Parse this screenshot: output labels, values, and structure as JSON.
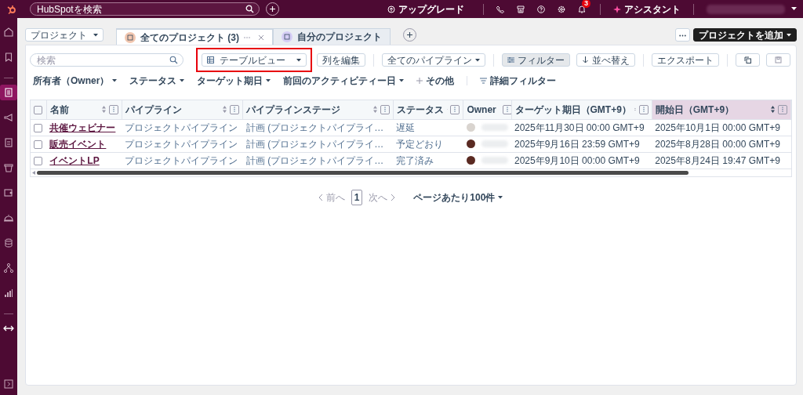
{
  "top_bar": {
    "search": {
      "placeholder": "HubSpotを検索"
    },
    "upgrade": "アップグレード",
    "notifications": {
      "count": "3"
    },
    "assistant": "アシスタント"
  },
  "sidebar": {
    "items": [
      {
        "selected": false
      },
      {
        "selected": false
      },
      {
        "selected": true
      },
      {
        "selected": false
      },
      {
        "selected": false
      },
      {
        "selected": false
      },
      {
        "selected": false
      },
      {
        "selected": false
      },
      {
        "selected": false
      },
      {
        "selected": false
      },
      {
        "selected": false
      },
      {
        "selected": false
      }
    ]
  },
  "object_menu": {
    "label": "プロジェクト"
  },
  "tabs": [
    {
      "label": "全てのプロジェクト (3)",
      "selected": true,
      "closable": true,
      "color": "#f2c7b0"
    },
    {
      "label": "自分のプロジェクト",
      "selected": false,
      "closable": false,
      "color": "#d5cdf5"
    }
  ],
  "add_button": "プロジェクトを追加",
  "toolbar": {
    "search": {
      "placeholder": "検索"
    },
    "button_groups": [
      [
        {
          "label": "テーブルビュー",
          "kind": "view",
          "active": false,
          "highlighted": true
        },
        {
          "label": "列を編集",
          "kind": "plain",
          "active": false,
          "highlighted": false
        }
      ],
      [
        {
          "label": "全てのパイプライン",
          "kind": "dropdown",
          "active": false,
          "highlighted": false
        }
      ],
      [
        {
          "label": "フィルター",
          "kind": "filter",
          "active": true,
          "highlighted": false
        },
        {
          "label": "並べ替え",
          "kind": "sort",
          "active": false,
          "highlighted": false
        }
      ],
      [
        {
          "label": "エクスポート",
          "kind": "plain",
          "active": false,
          "highlighted": false
        }
      ],
      [
        {
          "kind": "copy",
          "active": false,
          "highlighted": false
        },
        {
          "kind": "save",
          "active": false,
          "highlighted": false
        }
      ]
    ]
  },
  "filters": [
    {
      "label": "所有者（Owner）",
      "kind": "dropdown"
    },
    {
      "label": "ステータス",
      "kind": "dropdown"
    },
    {
      "label": "ターゲット期日",
      "kind": "dropdown"
    },
    {
      "label": "前回のアクティビティー日",
      "kind": "dropdown"
    },
    {
      "label": "その他",
      "kind": "add"
    },
    {
      "label": "詳細フィルター",
      "kind": "advanced"
    }
  ],
  "table": {
    "select_all": {
      "checked": false
    },
    "columns": [
      {
        "label": "名前",
        "sorted": false
      },
      {
        "label": "パイプライン",
        "sorted": false
      },
      {
        "label": "パイプラインステージ",
        "sorted": false
      },
      {
        "label": "ステータス",
        "sorted": false
      },
      {
        "label": "Owner",
        "sorted": false
      },
      {
        "label": "ターゲット期日（GMT+9）",
        "sorted": false
      },
      {
        "label": "開始日（GMT+9）",
        "sorted": true
      }
    ],
    "rows": [
      {
        "checked": false,
        "name": "共催ウェビナー",
        "pipeline": "プロジェクトパイプライン",
        "stage": "計画 (プロジェクトパイプライ…",
        "status": "遅延",
        "owner": {
          "color": "#d9d4cf"
        },
        "target_date": "2025年11月30日 00:00 GMT+9",
        "start_date": "2025年10月1日 00:00 GMT+9"
      },
      {
        "checked": false,
        "name": "販売イベント",
        "pipeline": "プロジェクトパイプライン",
        "stage": "計画 (プロジェクトパイプライ…",
        "status": "予定どおり",
        "owner": {
          "color": "#5a2a22"
        },
        "target_date": "2025年9月16日 23:59 GMT+9",
        "start_date": "2025年8月28日 00:00 GMT+9"
      },
      {
        "checked": false,
        "name": "イベントLP",
        "pipeline": "プロジェクトパイプライン",
        "stage": "計画 (プロジェクトパイプライ…",
        "status": "完了済み",
        "owner": {
          "color": "#5a2a22"
        },
        "target_date": "2025年9月10日 00:00 GMT+9",
        "start_date": "2025年8月24日 19:47 GMT+9"
      }
    ]
  },
  "pagination": {
    "previous": "前へ",
    "page": "1",
    "next": "次へ",
    "page_size": "ページあたり100件"
  }
}
